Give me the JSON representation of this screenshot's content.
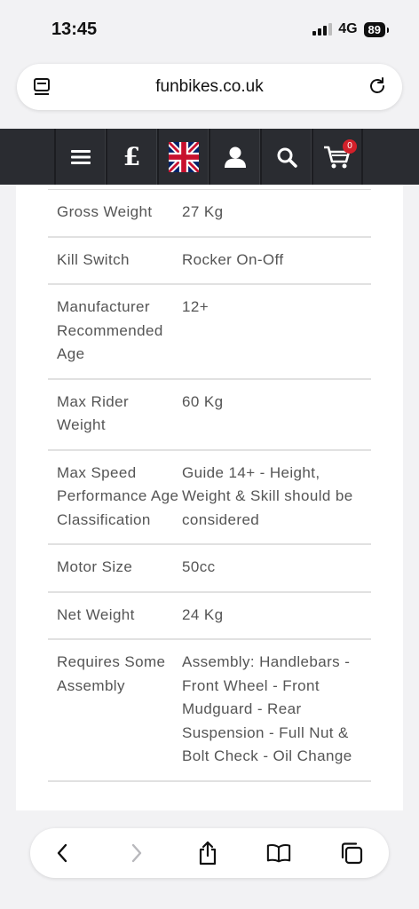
{
  "status": {
    "time": "13:45",
    "network": "4G",
    "battery": "89"
  },
  "browser": {
    "url": "funbikes.co.uk"
  },
  "nav": {
    "currency_symbol": "£",
    "cart_count": "0"
  },
  "specs": [
    {
      "key": "Gross Weight",
      "value": "27 Kg"
    },
    {
      "key": "Kill Switch",
      "value": "Rocker On-Off"
    },
    {
      "key": "Manufacturer Recommended Age",
      "value": "12+"
    },
    {
      "key": "Max Rider Weight",
      "value": "60 Kg"
    },
    {
      "key": "Max Speed Performance Age Classification",
      "value": "Guide 14+ - Height, Weight & Skill should be considered"
    },
    {
      "key": "Motor Size",
      "value": "50cc"
    },
    {
      "key": "Net Weight",
      "value": "24 Kg"
    },
    {
      "key": "Requires Some Assembly",
      "value": "Assembly: Handlebars - Front Wheel - Front Mudguard - Rear Suspension - Full Nut & Bolt Check - Oil Change"
    }
  ],
  "icons": {
    "reader": "reader-icon",
    "reload": "reload-icon",
    "menu": "menu-icon",
    "flag": "uk-flag-icon",
    "account": "user-icon",
    "search": "search-icon",
    "cart": "cart-icon",
    "back": "back-arrow-icon",
    "forward": "forward-arrow-icon",
    "share": "share-icon",
    "bookmarks": "bookmarks-icon",
    "tabs": "tabs-icon"
  },
  "colors": {
    "nav_bg": "#2a2c31",
    "badge": "#d3202a",
    "page_bg": "#f2f2f4"
  }
}
